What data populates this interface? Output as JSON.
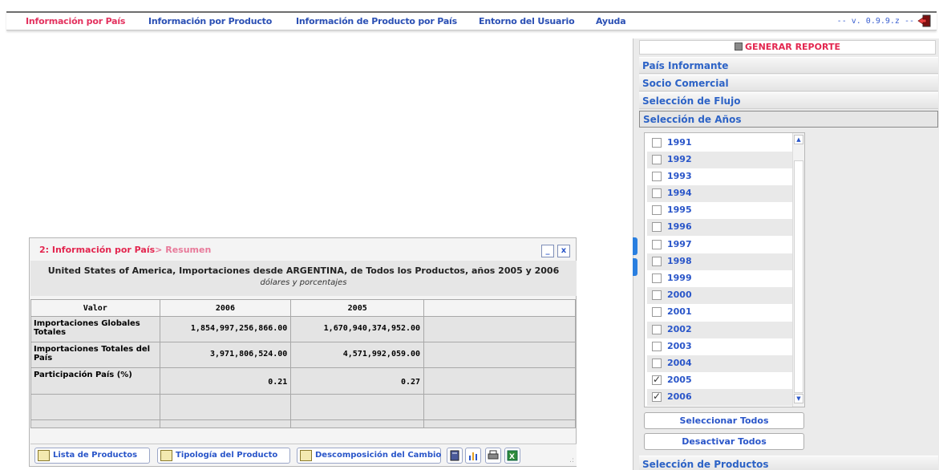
{
  "menu": {
    "items": [
      {
        "label": "Información por País",
        "active": true
      },
      {
        "label": "Información por Producto",
        "active": false
      },
      {
        "label": "Información de Producto por País",
        "active": false
      },
      {
        "label": "Entorno del Usuario",
        "active": false
      },
      {
        "label": "Ayuda",
        "active": false
      }
    ],
    "version": "-- v. 0.9.9.z --"
  },
  "panel": {
    "generate_label": "GENERAR REPORTE",
    "sections": [
      {
        "label": "País Informante"
      },
      {
        "label": "Socio Comercial"
      },
      {
        "label": "Selección de Flujo"
      },
      {
        "label": "Selección de Años"
      }
    ],
    "years": [
      {
        "label": "1991",
        "checked": false
      },
      {
        "label": "1992",
        "checked": false
      },
      {
        "label": "1993",
        "checked": false
      },
      {
        "label": "1994",
        "checked": false
      },
      {
        "label": "1995",
        "checked": false
      },
      {
        "label": "1996",
        "checked": false
      },
      {
        "label": "1997",
        "checked": false
      },
      {
        "label": "1998",
        "checked": false
      },
      {
        "label": "1999",
        "checked": false
      },
      {
        "label": "2000",
        "checked": false
      },
      {
        "label": "2001",
        "checked": false
      },
      {
        "label": "2002",
        "checked": false
      },
      {
        "label": "2003",
        "checked": false
      },
      {
        "label": "2004",
        "checked": false
      },
      {
        "label": "2005",
        "checked": true
      },
      {
        "label": "2006",
        "checked": true
      }
    ],
    "select_all_label": "Seleccionar Todos",
    "deselect_all_label": "Desactivar Todos",
    "products_section_label": "Selección de Productos"
  },
  "window": {
    "title": "2: Información por País",
    "title_crumb": "> Resumen",
    "minimize_label": "_",
    "close_label": "x",
    "heading": "United States of America, Importaciones desde ARGENTINA, de Todos los Productos, años 2005 y 2006",
    "subheading": "dólares y porcentajes",
    "table": {
      "headers": [
        "Valor",
        "2006",
        "2005",
        ""
      ],
      "rows": [
        {
          "label": "Importaciones Globales Totales",
          "v2006": "1,854,997,256,866.00",
          "v2005": "1,670,940,374,952.00"
        },
        {
          "label": "Importaciones Totales del País",
          "v2006": "3,971,806,524.00",
          "v2005": "4,571,992,059.00"
        },
        {
          "label": "Participación País (%)",
          "v2006": "0.21",
          "v2005": "0.27"
        }
      ]
    },
    "toolbar": {
      "product_list_label": "Lista de Productos",
      "product_typology_label": "Tipología del Producto",
      "change_decomposition_label": "Descomposición del Cambio"
    }
  }
}
